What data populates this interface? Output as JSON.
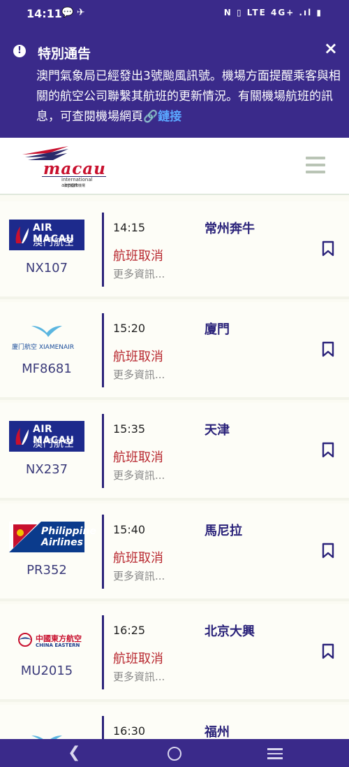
{
  "status_bar": {
    "time": "14:11",
    "left_icons": "💬 ✈",
    "right_icons": "N ▯ LTE 4G+ .ıl ▮"
  },
  "notice": {
    "title": "特別通告",
    "body": "澳門氣象局已經發出3號颱風訊號。機場方面提醒乘客與相關的航空公司聯繫其航班的更新情況。有關機場航班的訊息，可查閱機場網頁",
    "link_text": "🔗鏈接",
    "close_label": "×"
  },
  "header": {
    "logo_brand": "macau",
    "logo_sub": "international airport",
    "logo_cn": "澳門國際機場"
  },
  "flights": [
    {
      "airline": "airmacau",
      "logo_en": "AIR MACAU",
      "logo_cn": "澳門航空",
      "flight_no": "NX107",
      "time": "14:15",
      "destination": "常州奔牛",
      "status": "航班取消",
      "more": "更多資訊..."
    },
    {
      "airline": "xiamen",
      "logo_text": "廈门航空 XIAMENAIR",
      "flight_no": "MF8681",
      "time": "15:20",
      "destination": "廈門",
      "status": "航班取消",
      "more": "更多資訊..."
    },
    {
      "airline": "airmacau",
      "logo_en": "AIR MACAU",
      "logo_cn": "澳門航空",
      "flight_no": "NX237",
      "time": "15:35",
      "destination": "天津",
      "status": "航班取消",
      "more": "更多資訊..."
    },
    {
      "airline": "pal",
      "logo_text1": "Philippine",
      "logo_text2": "Airlines",
      "flight_no": "PR352",
      "time": "15:40",
      "destination": "馬尼拉",
      "status": "航班取消",
      "more": "更多資訊..."
    },
    {
      "airline": "ce",
      "logo_cn": "中國東方航空",
      "logo_en": "CHINA EASTERN",
      "flight_no": "MU2015",
      "time": "16:25",
      "destination": "北京大興",
      "status": "航班取消",
      "more": "更多資訊..."
    },
    {
      "airline": "xiamen",
      "time": "16:30",
      "destination": "福州"
    }
  ],
  "colors": {
    "brand_purple": "#3a2a8a",
    "cancel_red": "#b8282f",
    "link_blue": "#5aa7ff"
  }
}
